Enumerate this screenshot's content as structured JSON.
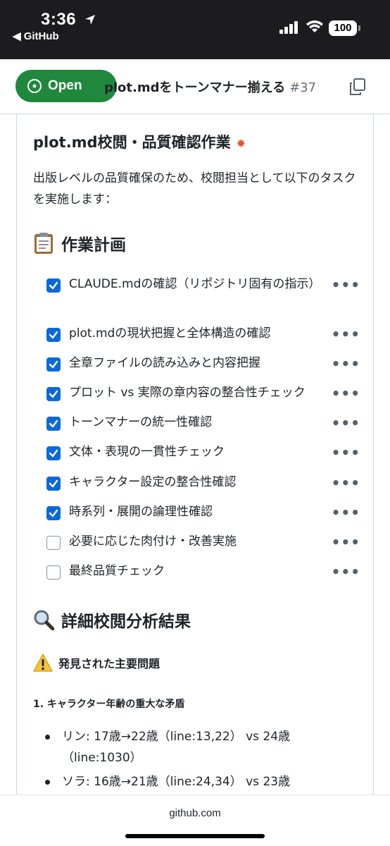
{
  "status_bar": {
    "time": "3:36",
    "back_app": "◀ GitHub",
    "battery": "100"
  },
  "header": {
    "state_label": "Open",
    "title": "plot.mdをトーンマナー揃える",
    "number": "#37"
  },
  "body": {
    "heading": "plot.md校閲・品質確認作業",
    "intro": "出版レベルの品質確保のため、校閲担当として以下のタスクを実施します：",
    "plan_heading": "作業計画",
    "tasks": [
      {
        "label": "CLAUDE.mdの確認（リポジトリ固有の指示）",
        "checked": true
      },
      {
        "label": "plot.mdの現状把握と全体構造の確認",
        "checked": true
      },
      {
        "label": "全章ファイルの読み込みと内容把握",
        "checked": true
      },
      {
        "label": "プロット vs 実際の章内容の整合性チェック",
        "checked": true
      },
      {
        "label": "トーンマナーの統一性確認",
        "checked": true
      },
      {
        "label": "文体・表現の一貫性チェック",
        "checked": true
      },
      {
        "label": "キャラクター設定の整合性確認",
        "checked": true
      },
      {
        "label": "時系列・展開の論理性確認",
        "checked": true
      },
      {
        "label": "必要に応じた肉付け・改善実施",
        "checked": false
      },
      {
        "label": "最終品質チェック",
        "checked": false
      }
    ],
    "task_menu": "•••",
    "analysis_heading": "詳細校閲分析結果",
    "issues_heading": "発見された主要問題",
    "issue_1_title": "1. キャラクター年齢の重大な矛盾",
    "bullets": [
      {
        "text": "リン: 17歳→22歳（line:13,22） vs 24歳（line:1030）"
      },
      {
        "text": "ソラ: 16歳→21歳（line:24,34） vs 23歳"
      }
    ]
  },
  "bottom_bar": {
    "domain": "github.com"
  },
  "colors": {
    "open_green": "#1f883d",
    "checkbox_blue": "#0969da",
    "status_bar_bg": "#1c1c1e"
  }
}
